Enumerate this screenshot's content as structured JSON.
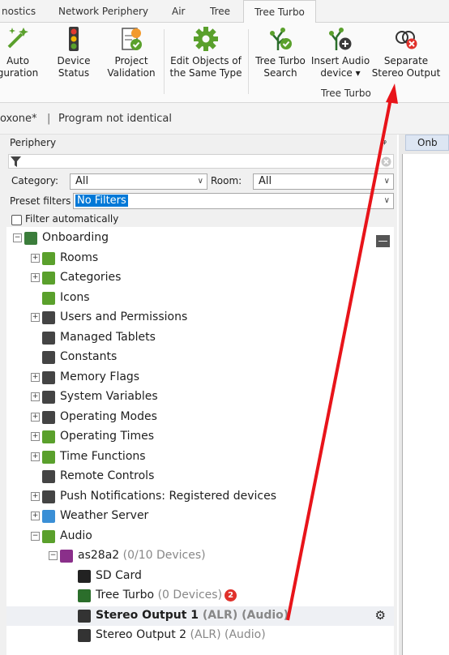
{
  "tabs": [
    {
      "label": "nostics",
      "active": false
    },
    {
      "label": "Network Periphery",
      "active": false
    },
    {
      "label": "Air",
      "active": false
    },
    {
      "label": "Tree",
      "active": false
    },
    {
      "label": "Tree Turbo",
      "active": true
    }
  ],
  "ribbon": {
    "buttons": [
      {
        "line1": "Auto",
        "line2": "guration",
        "icon": "magic-wand-icon"
      },
      {
        "line1": "Device",
        "line2": "Status",
        "icon": "traffic-light-icon"
      },
      {
        "line1": "Project",
        "line2": "Validation",
        "icon": "validation-clipboard-icon"
      },
      {
        "line1": "Edit Objects of",
        "line2": "the Same Type",
        "icon": "gear-icon"
      },
      {
        "line1": "Tree Turbo",
        "line2": "Search",
        "icon": "tree-search-icon"
      },
      {
        "line1": "Insert Audio",
        "line2": "device ▾",
        "icon": "insert-audio-device-icon"
      },
      {
        "line1": "Separate",
        "line2": "Stereo Output",
        "icon": "separate-stereo-icon"
      }
    ],
    "group_label": "Tree Turbo"
  },
  "status": {
    "project": "oxone*",
    "separator": "|",
    "message": "Program not identical"
  },
  "panel": {
    "title": "Periphery",
    "pin": "ᵩ",
    "category_label": "Category:",
    "category_value": "All",
    "room_label": "Room:",
    "room_value": "All",
    "preset_label": "Preset filters",
    "preset_value": "No Filters",
    "filter_auto_label": "Filter automatically",
    "filter_auto_checked": false
  },
  "right_tab": "Onb",
  "tree": [
    {
      "label": "Onboarding",
      "level": 0,
      "expander": "minus",
      "icon": "project-icon",
      "color": "#3b7d3b"
    },
    {
      "label": "Rooms",
      "level": 1,
      "expander": "plus",
      "icon": "rooms-icon",
      "color": "#5aa02c"
    },
    {
      "label": "Categories",
      "level": 1,
      "expander": "plus",
      "icon": "categories-icon",
      "color": "#5aa02c"
    },
    {
      "label": "Icons",
      "level": 1,
      "expander": "none",
      "icon": "image-icon",
      "color": "#5aa02c"
    },
    {
      "label": "Users and Permissions",
      "level": 1,
      "expander": "plus",
      "icon": "users-icon",
      "color": "#444444"
    },
    {
      "label": "Managed Tablets",
      "level": 1,
      "expander": "none",
      "icon": "tablet-icon",
      "color": "#444444"
    },
    {
      "label": "Constants",
      "level": 1,
      "expander": "none",
      "icon": "constants-icon",
      "color": "#444444"
    },
    {
      "label": "Memory Flags",
      "level": 1,
      "expander": "plus",
      "icon": "memory-flag-icon",
      "color": "#444444"
    },
    {
      "label": "System Variables",
      "level": 1,
      "expander": "plus",
      "icon": "variables-icon",
      "color": "#444444"
    },
    {
      "label": "Operating Modes",
      "level": 1,
      "expander": "plus",
      "icon": "operating-modes-icon",
      "color": "#444444"
    },
    {
      "label": "Operating Times",
      "level": 1,
      "expander": "plus",
      "icon": "calendar-icon",
      "color": "#5aa02c"
    },
    {
      "label": "Time Functions",
      "level": 1,
      "expander": "plus",
      "icon": "clock-icon",
      "color": "#5aa02c"
    },
    {
      "label": "Remote Controls",
      "level": 1,
      "expander": "none",
      "icon": "remote-icon",
      "color": "#444444"
    },
    {
      "label": "Push Notifications: Registered devices",
      "level": 1,
      "expander": "plus",
      "icon": "push-notification-icon",
      "color": "#444444"
    },
    {
      "label": "Weather Server",
      "level": 1,
      "expander": "plus",
      "icon": "weather-icon",
      "color": "#3a8fd6"
    },
    {
      "label": "Audio",
      "level": 1,
      "expander": "minus",
      "icon": "music-icon",
      "color": "#5aa02c"
    },
    {
      "label": "as28a2",
      "suffix": " (0/10 Devices)",
      "level": 2,
      "expander": "minus",
      "icon": "audioserver-icon",
      "color": "#8a2f8a"
    },
    {
      "label": "SD Card",
      "level": 3,
      "expander": "none",
      "icon": "sd-card-icon",
      "color": "#222222"
    },
    {
      "label": "Tree Turbo",
      "suffix": " (0 Devices)",
      "badge": "2",
      "level": 3,
      "expander": "none",
      "icon": "tree-turbo-icon",
      "color": "#2b6e2b"
    },
    {
      "label": "Stereo Output 1",
      "suffix": " (ALR) (Audio)",
      "level": 3,
      "expander": "none",
      "icon": "stereo-icon",
      "color": "#333333",
      "selected": true,
      "bold": true
    },
    {
      "label": "Stereo Output 2",
      "suffix": " (ALR) (Audio)",
      "level": 3,
      "expander": "none",
      "icon": "stereo-icon",
      "color": "#333333"
    }
  ],
  "colors": {
    "accent": "#0078d7",
    "arrow": "#e8141a",
    "green": "#5aa02c"
  }
}
